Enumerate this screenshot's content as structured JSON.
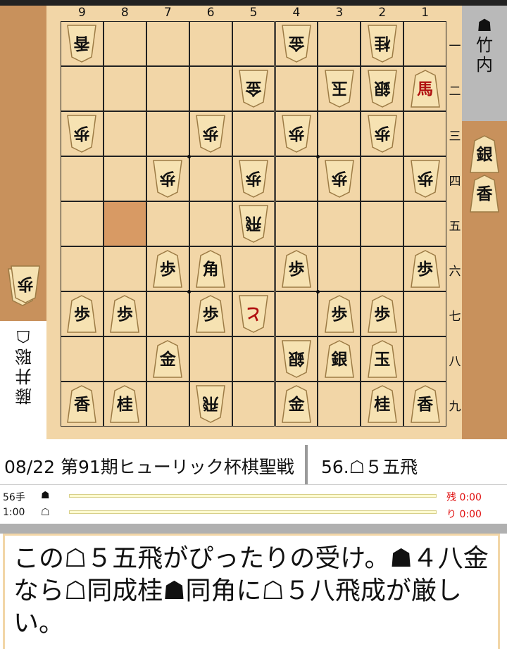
{
  "players": {
    "sente": {
      "mark": "☗",
      "name": "竹内"
    },
    "gote": {
      "mark": "☖",
      "name": "藤井聡"
    }
  },
  "board": {
    "files": [
      "9",
      "8",
      "7",
      "6",
      "5",
      "4",
      "3",
      "2",
      "1"
    ],
    "ranks": [
      "一",
      "二",
      "三",
      "四",
      "五",
      "六",
      "七",
      "八",
      "九"
    ],
    "highlight_square": "8五",
    "pieces": [
      {
        "sq": "9一",
        "k": "香",
        "owner": "gote"
      },
      {
        "sq": "4一",
        "k": "金",
        "owner": "gote"
      },
      {
        "sq": "2一",
        "k": "桂",
        "owner": "gote"
      },
      {
        "sq": "5二",
        "k": "金",
        "owner": "gote"
      },
      {
        "sq": "3二",
        "k": "玉",
        "owner": "gote"
      },
      {
        "sq": "2二",
        "k": "銀",
        "owner": "gote"
      },
      {
        "sq": "1二",
        "k": "馬",
        "owner": "sente",
        "promoted": true
      },
      {
        "sq": "9三",
        "k": "歩",
        "owner": "gote"
      },
      {
        "sq": "6三",
        "k": "歩",
        "owner": "gote"
      },
      {
        "sq": "4三",
        "k": "歩",
        "owner": "gote"
      },
      {
        "sq": "2三",
        "k": "歩",
        "owner": "gote"
      },
      {
        "sq": "7四",
        "k": "歩",
        "owner": "gote"
      },
      {
        "sq": "5四",
        "k": "歩",
        "owner": "gote"
      },
      {
        "sq": "3四",
        "k": "歩",
        "owner": "gote"
      },
      {
        "sq": "1四",
        "k": "歩",
        "owner": "gote"
      },
      {
        "sq": "5五",
        "k": "飛",
        "owner": "gote"
      },
      {
        "sq": "7六",
        "k": "歩",
        "owner": "sente"
      },
      {
        "sq": "6六",
        "k": "角",
        "owner": "sente"
      },
      {
        "sq": "4六",
        "k": "歩",
        "owner": "sente"
      },
      {
        "sq": "1六",
        "k": "歩",
        "owner": "sente"
      },
      {
        "sq": "9七",
        "k": "歩",
        "owner": "sente"
      },
      {
        "sq": "8七",
        "k": "歩",
        "owner": "sente"
      },
      {
        "sq": "6七",
        "k": "歩",
        "owner": "sente"
      },
      {
        "sq": "5七",
        "k": "と",
        "owner": "gote",
        "promoted": true
      },
      {
        "sq": "3七",
        "k": "歩",
        "owner": "sente"
      },
      {
        "sq": "2七",
        "k": "歩",
        "owner": "sente"
      },
      {
        "sq": "7八",
        "k": "金",
        "owner": "sente"
      },
      {
        "sq": "4八",
        "k": "銀",
        "owner": "gote"
      },
      {
        "sq": "3八",
        "k": "銀",
        "owner": "sente"
      },
      {
        "sq": "2八",
        "k": "玉",
        "owner": "sente"
      },
      {
        "sq": "9九",
        "k": "香",
        "owner": "sente"
      },
      {
        "sq": "8九",
        "k": "桂",
        "owner": "sente"
      },
      {
        "sq": "6九",
        "k": "飛",
        "owner": "gote"
      },
      {
        "sq": "4九",
        "k": "金",
        "owner": "sente"
      },
      {
        "sq": "2九",
        "k": "桂",
        "owner": "sente"
      },
      {
        "sq": "1九",
        "k": "香",
        "owner": "sente"
      }
    ]
  },
  "hands": {
    "sente": [
      "銀",
      "香"
    ],
    "gote": [
      "歩",
      "歩"
    ]
  },
  "game_title": "08/22 第91期ヒューリック杯棋聖戦",
  "current_move": "56.☖５五飛",
  "timer": {
    "move_count": "56手",
    "time_setting": "1:00",
    "sente_mark": "☗",
    "gote_mark": "☖",
    "sente_remaining": "残 0:00",
    "gote_remaining": "り 0:00"
  },
  "comment": "この☖５五飛がぴったりの受け。☗４八金なら☖同成桂☗同角に☖５八飛成が厳しい。"
}
